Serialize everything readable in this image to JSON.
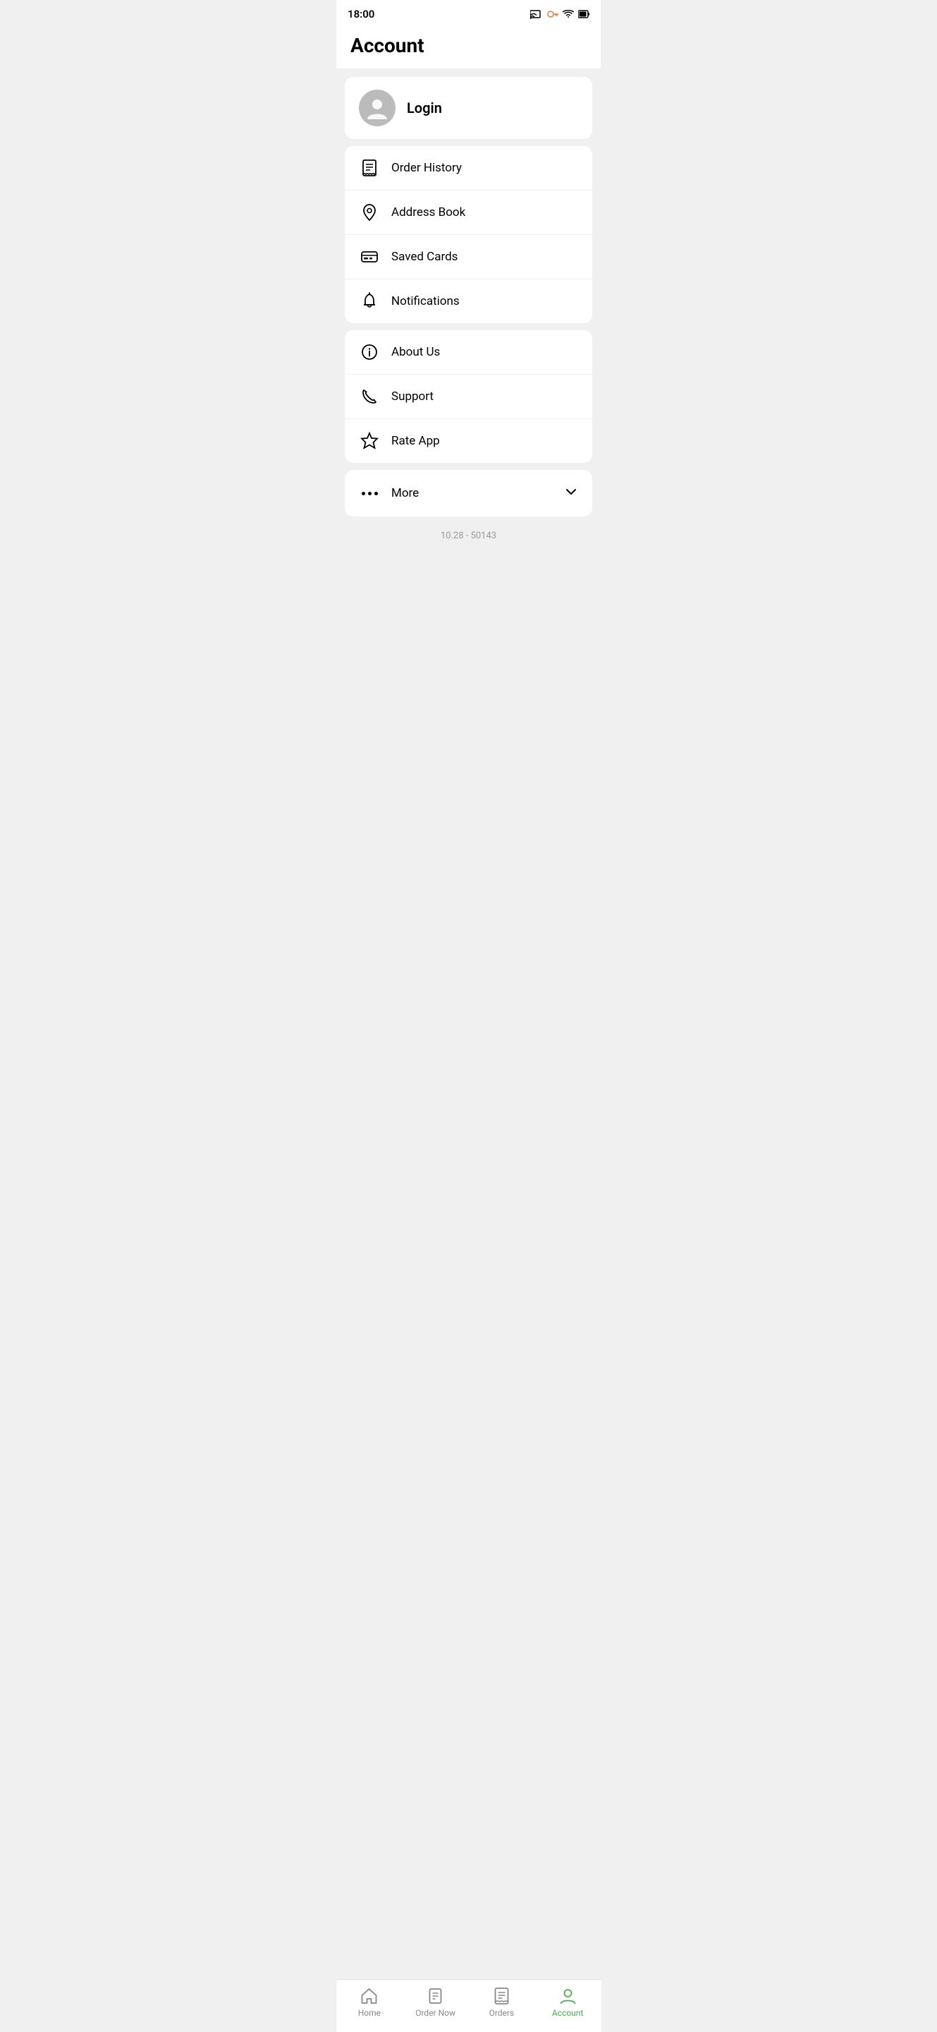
{
  "statusBar": {
    "time": "18:00",
    "icons": [
      "info",
      "shield",
      "refresh",
      "stop",
      "dot"
    ]
  },
  "pageTitle": "Account",
  "loginSection": {
    "loginLabel": "Login"
  },
  "menuSection1": {
    "items": [
      {
        "id": "order-history",
        "label": "Order History",
        "icon": "receipt"
      },
      {
        "id": "address-book",
        "label": "Address Book",
        "icon": "location"
      },
      {
        "id": "saved-cards",
        "label": "Saved Cards",
        "icon": "card"
      },
      {
        "id": "notifications",
        "label": "Notifications",
        "icon": "bell"
      }
    ]
  },
  "menuSection2": {
    "items": [
      {
        "id": "about-us",
        "label": "About Us",
        "icon": "info"
      },
      {
        "id": "support",
        "label": "Support",
        "icon": "phone"
      },
      {
        "id": "rate-app",
        "label": "Rate App",
        "icon": "star"
      }
    ]
  },
  "moreSection": {
    "label": "More"
  },
  "versionText": "10.28 - 50143",
  "bottomNav": {
    "items": [
      {
        "id": "home",
        "label": "Home",
        "icon": "home",
        "active": false
      },
      {
        "id": "order-now",
        "label": "Order Now",
        "icon": "order-now",
        "active": false
      },
      {
        "id": "orders",
        "label": "Orders",
        "icon": "orders",
        "active": false
      },
      {
        "id": "account",
        "label": "Account",
        "icon": "account",
        "active": true
      }
    ]
  }
}
